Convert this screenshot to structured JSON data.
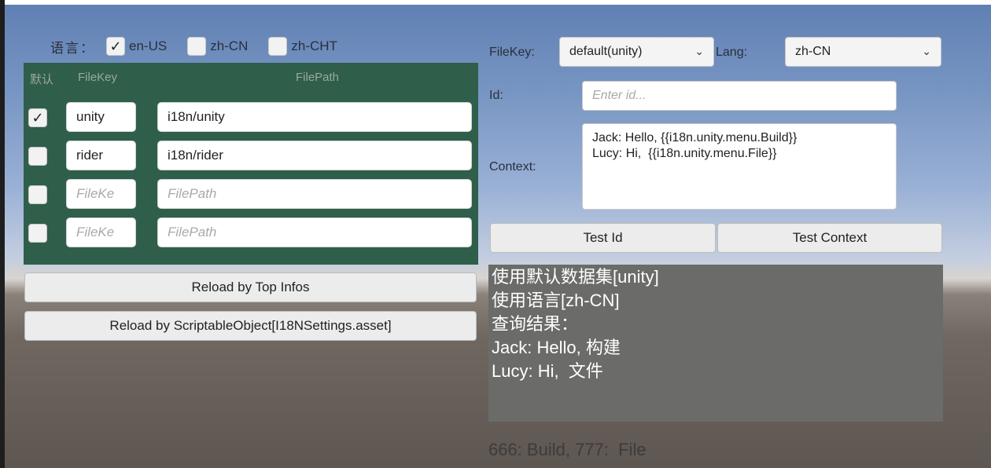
{
  "language_row": {
    "label": "语言：",
    "options": [
      {
        "label": "en-US",
        "checked": true
      },
      {
        "label": "zh-CN",
        "checked": false
      },
      {
        "label": "zh-CHT",
        "checked": false
      }
    ]
  },
  "table": {
    "headers": {
      "default": "默认",
      "filekey": "FileKey",
      "filepath": "FilePath"
    },
    "rows": [
      {
        "checked": true,
        "key": "unity",
        "path": "i18n/unity"
      },
      {
        "checked": false,
        "key": "rider",
        "path": "i18n/rider"
      },
      {
        "checked": false,
        "key_placeholder": "FileKe",
        "path_placeholder": "FilePath"
      },
      {
        "checked": false,
        "key_placeholder": "FileKe",
        "path_placeholder": "FilePath"
      }
    ]
  },
  "buttons": {
    "reload_top": "Reload by Top Infos",
    "reload_so": "Reload by ScriptableObject[I18NSettings.asset]",
    "test_id": "Test Id",
    "test_context": "Test Context"
  },
  "right": {
    "filekey_label": "FileKey:",
    "filekey_value": "default(unity)",
    "lang_label": "Lang:",
    "lang_value": "zh-CN",
    "id_label": "Id:",
    "id_placeholder": "Enter id...",
    "context_label": "Context:",
    "context_lines": [
      "Jack: Hello, {{i18n.unity.menu.Build}}",
      "Lucy: Hi,  {{i18n.unity.menu.File}}"
    ]
  },
  "result": {
    "lines": [
      "使用默认数据集[unity]",
      "使用语言[zh-CN]",
      "查询结果：",
      "Jack: Hello, 构建",
      "Lucy: Hi,  文件"
    ]
  },
  "footer": {
    "text": "666: Build, 777:  File"
  },
  "icons": {
    "check": "check-icon",
    "chevron": "chevron-down-icon"
  },
  "colors": {
    "panel": "#2f5e4a",
    "result_bg": "#6b6b69"
  }
}
